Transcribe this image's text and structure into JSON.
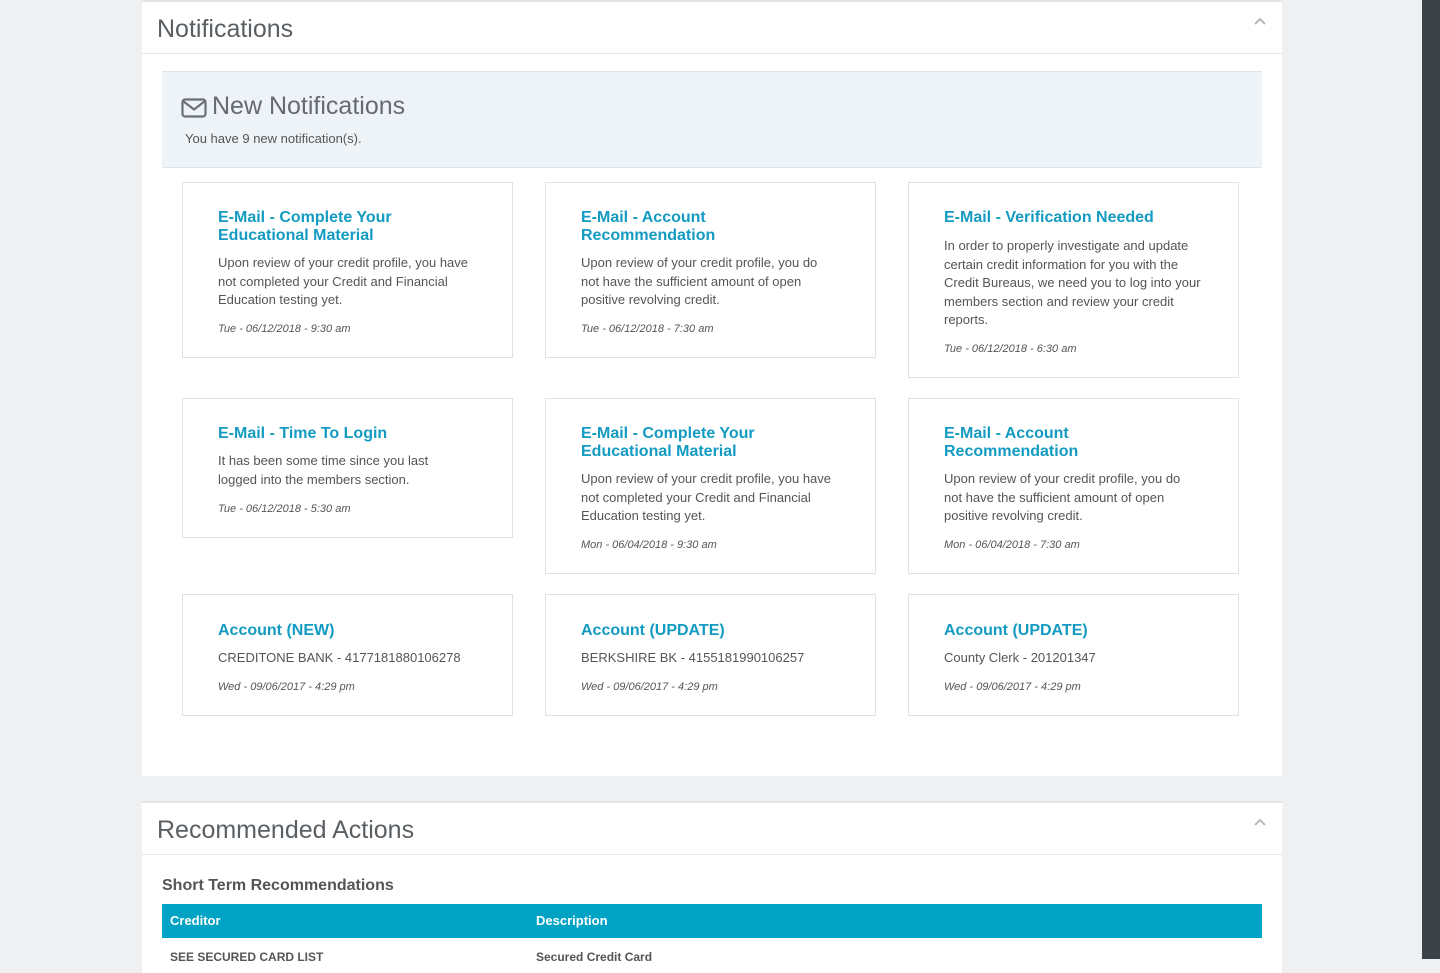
{
  "notifications_panel": {
    "title": "Notifications",
    "summary_title": "New Notifications",
    "summary_count": "You have 9 new notification(s).",
    "cards": [
      {
        "title": "E-Mail - Complete Your Educational Material",
        "body": "Upon review of your credit profile, you have not completed your Credit and Financial Education testing yet.",
        "date": "Tue - 06/12/2018 - 9:30 am"
      },
      {
        "title": "E-Mail - Account Recommendation",
        "body": "Upon review of your credit profile, you do not have the sufficient amount of open positive revolving credit.",
        "date": "Tue - 06/12/2018 - 7:30 am"
      },
      {
        "title": "E-Mail - Verification Needed",
        "body": "In order to properly investigate and update certain credit information for you with the Credit Bureaus, we need you to log into your members section and review your credit reports.",
        "date": "Tue - 06/12/2018 - 6:30 am"
      },
      {
        "title": "E-Mail - Time To Login",
        "body": "It has been some time since you last logged into the members section.",
        "date": "Tue - 06/12/2018 - 5:30 am"
      },
      {
        "title": "E-Mail - Complete Your Educational Material",
        "body": "Upon review of your credit profile, you have not completed your Credit and Financial Education testing yet.",
        "date": "Mon - 06/04/2018 - 9:30 am"
      },
      {
        "title": "E-Mail - Account Recommendation",
        "body": "Upon review of your credit profile, you do not have the sufficient amount of open positive revolving credit.",
        "date": "Mon - 06/04/2018 - 7:30 am"
      },
      {
        "title": "Account (NEW)",
        "body": "CREDITONE BANK - 4177181880106278",
        "date": "Wed - 09/06/2017 - 4:29 pm"
      },
      {
        "title": "Account (UPDATE)",
        "body": "BERKSHIRE BK - 4155181990106257",
        "date": "Wed - 09/06/2017 - 4:29 pm"
      },
      {
        "title": "Account (UPDATE)",
        "body": "County Clerk - 201201347",
        "date": "Wed - 09/06/2017 - 4:29 pm"
      }
    ]
  },
  "recommended_panel": {
    "title": "Recommended Actions",
    "subtitle": "Short Term Recommendations",
    "columns": [
      "Creditor",
      "Description"
    ],
    "rows": [
      {
        "creditor": "SEE SECURED CARD LIST",
        "description": "Secured Credit Card"
      }
    ]
  },
  "colors": {
    "accent": "#139bc2",
    "table_header": "#00a3c4",
    "summary_bg": "#eef3f7"
  },
  "icons": {
    "summary": "envelope-icon",
    "collapse": "chevron-up-icon"
  }
}
